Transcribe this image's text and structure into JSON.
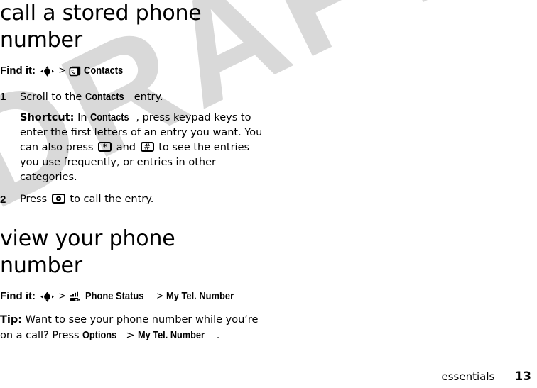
{
  "watermark": {
    "text": "DRAFT"
  },
  "sections": [
    {
      "heading": "call a stored phone number",
      "find_it": {
        "label": "Find it:",
        "separator": ">",
        "nav_icon": "navigation-key-icon",
        "target_icon": "contacts-icon",
        "target": "Contacts"
      },
      "steps": [
        {
          "number": "1",
          "text_before": "Scroll to the ",
          "bold_term": "Contacts",
          "text_after": " entry.",
          "note": {
            "lead": "Shortcut:",
            "part1": " In ",
            "bold_term": "Contacts",
            "part2": ", press keypad keys to enter the first letters of an entry you want. You can also press ",
            "key1": "*",
            "part3": " and ",
            "key2": "#",
            "part4": " to see the entries you use frequently, or entries in other categories."
          }
        },
        {
          "number": "2",
          "text_before": "Press ",
          "key_icon": "send-key-icon",
          "text_after": " to call the entry."
        }
      ]
    },
    {
      "heading": "view your phone number",
      "find_it": {
        "label": "Find it:",
        "separator": ">",
        "nav_icon": "navigation-key-icon",
        "target_icon": "phone-status-icon",
        "target": "Phone Status",
        "separator2": ">",
        "target2": "My Tel. Number"
      },
      "tip": {
        "lead": "Tip:",
        "part1": " Want to see your phone number while you’re on a call? Press ",
        "bold_term1": "Options",
        "separator": " > ",
        "bold_term2": "My Tel. Number",
        "part2": "."
      }
    }
  ],
  "footer": {
    "chapter": "essentials",
    "page_number": "13"
  },
  "colors": {
    "text": "#000000",
    "watermark": "#d9d9d9",
    "background": "#ffffff"
  }
}
